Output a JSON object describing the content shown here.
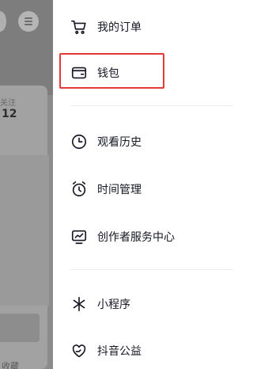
{
  "background": {
    "follow_label": "关注",
    "follow_count": "12",
    "bottom_text": "收藏"
  },
  "drawer": {
    "items": [
      {
        "label": "我的订单",
        "icon": "shopping-cart-icon"
      },
      {
        "label": "钱包",
        "icon": "wallet-icon"
      },
      {
        "label": "观看历史",
        "icon": "clock-icon"
      },
      {
        "label": "时间管理",
        "icon": "alarm-clock-icon"
      },
      {
        "label": "创作者服务中心",
        "icon": "creator-chart-icon"
      },
      {
        "label": "小程序",
        "icon": "mini-program-icon"
      },
      {
        "label": "抖音公益",
        "icon": "heart-hands-icon"
      }
    ]
  },
  "highlight_color": "#e53935"
}
